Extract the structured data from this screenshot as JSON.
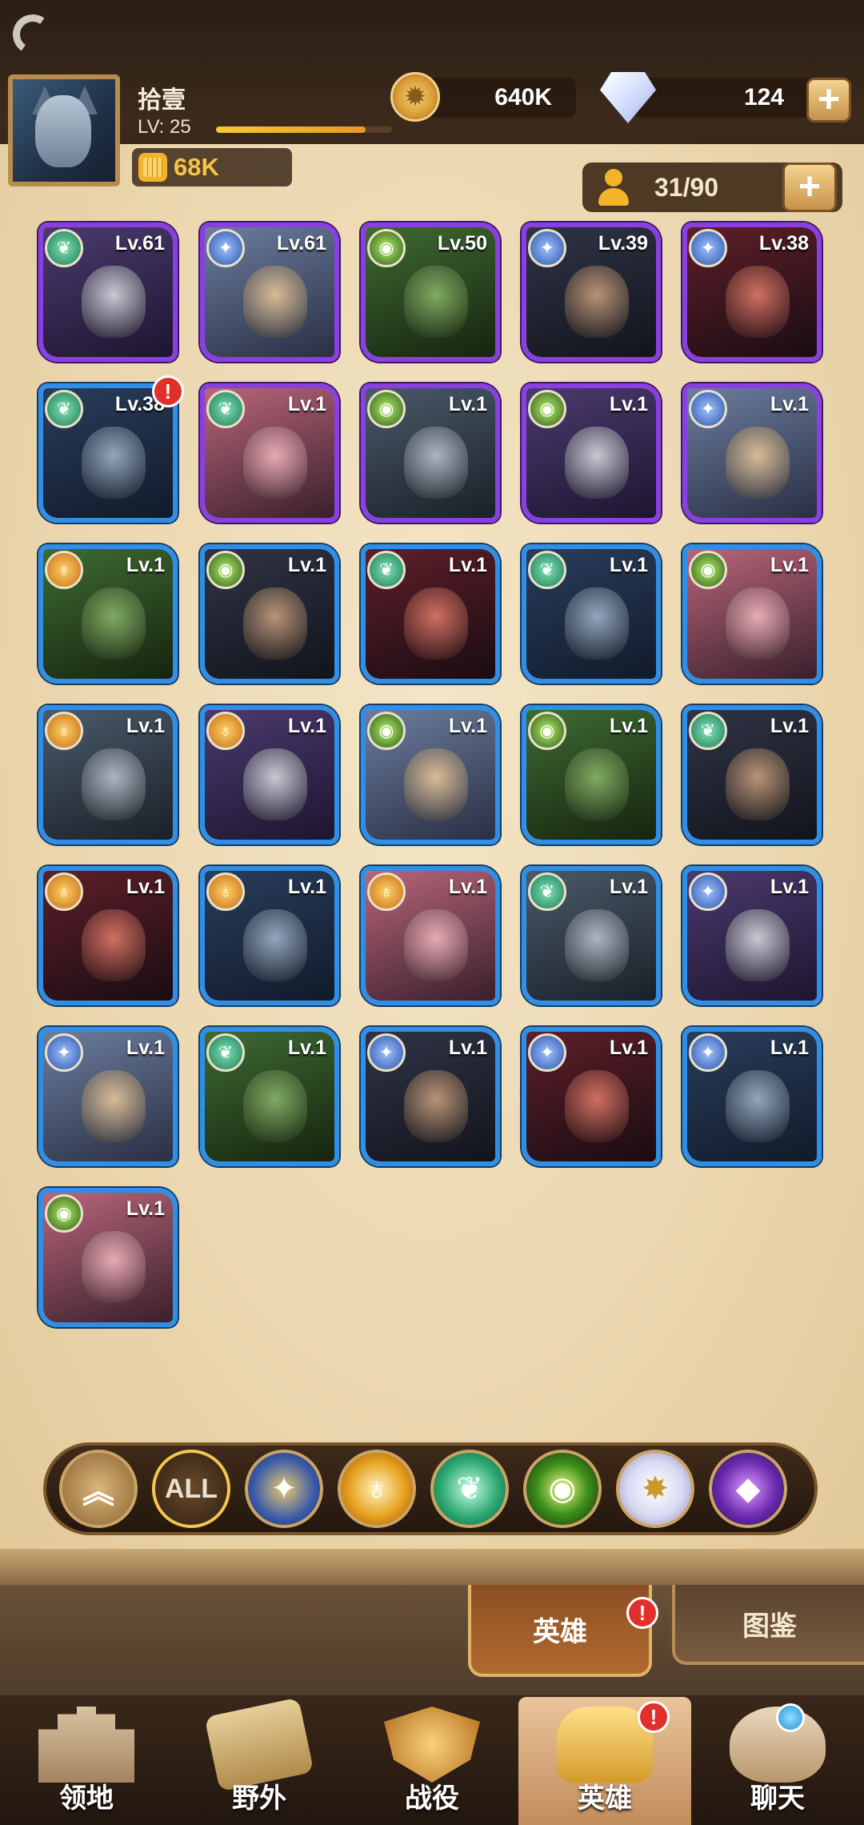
{
  "player": {
    "name": "拾壹",
    "level_label": "LV: 25",
    "xp_progress": 0.85,
    "power": "68K"
  },
  "currency": {
    "gold": "640K",
    "diamonds": "124",
    "gold_plus": "+",
    "diamond_plus": "+"
  },
  "roster": {
    "capacity": "31/90",
    "plus": "+"
  },
  "heroes": [
    {
      "level": "Lv.61",
      "faction": "wild",
      "rarity": "purple"
    },
    {
      "level": "Lv.61",
      "faction": "light",
      "rarity": "purple"
    },
    {
      "level": "Lv.50",
      "faction": "grave",
      "rarity": "purple"
    },
    {
      "level": "Lv.39",
      "faction": "light",
      "rarity": "purple"
    },
    {
      "level": "Lv.38",
      "faction": "light",
      "rarity": "purple"
    },
    {
      "level": "Lv.38",
      "faction": "wild",
      "rarity": "blue",
      "alert": "!"
    },
    {
      "level": "Lv.1",
      "faction": "wild",
      "rarity": "purple"
    },
    {
      "level": "Lv.1",
      "faction": "grave",
      "rarity": "purple"
    },
    {
      "level": "Lv.1",
      "faction": "grave",
      "rarity": "purple"
    },
    {
      "level": "Lv.1",
      "faction": "light",
      "rarity": "purple"
    },
    {
      "level": "Lv.1",
      "faction": "mauler",
      "rarity": "blue"
    },
    {
      "level": "Lv.1",
      "faction": "grave",
      "rarity": "blue"
    },
    {
      "level": "Lv.1",
      "faction": "wild",
      "rarity": "blue"
    },
    {
      "level": "Lv.1",
      "faction": "wild",
      "rarity": "blue"
    },
    {
      "level": "Lv.1",
      "faction": "grave",
      "rarity": "blue"
    },
    {
      "level": "Lv.1",
      "faction": "mauler",
      "rarity": "blue"
    },
    {
      "level": "Lv.1",
      "faction": "mauler",
      "rarity": "blue"
    },
    {
      "level": "Lv.1",
      "faction": "grave",
      "rarity": "blue"
    },
    {
      "level": "Lv.1",
      "faction": "grave",
      "rarity": "blue"
    },
    {
      "level": "Lv.1",
      "faction": "wild",
      "rarity": "blue"
    },
    {
      "level": "Lv.1",
      "faction": "mauler",
      "rarity": "blue"
    },
    {
      "level": "Lv.1",
      "faction": "mauler",
      "rarity": "blue"
    },
    {
      "level": "Lv.1",
      "faction": "mauler",
      "rarity": "blue"
    },
    {
      "level": "Lv.1",
      "faction": "wild",
      "rarity": "blue"
    },
    {
      "level": "Lv.1",
      "faction": "light",
      "rarity": "blue"
    },
    {
      "level": "Lv.1",
      "faction": "light",
      "rarity": "blue"
    },
    {
      "level": "Lv.1",
      "faction": "wild",
      "rarity": "blue"
    },
    {
      "level": "Lv.1",
      "faction": "light",
      "rarity": "blue"
    },
    {
      "level": "Lv.1",
      "faction": "light",
      "rarity": "blue"
    },
    {
      "level": "Lv.1",
      "faction": "light",
      "rarity": "blue"
    },
    {
      "level": "Lv.1",
      "faction": "grave",
      "rarity": "blue"
    }
  ],
  "filters": {
    "all_label": "ALL",
    "items": [
      "rank-up",
      "all",
      "lightbearer",
      "mauler",
      "wilder",
      "graveborn",
      "celestial",
      "hypogean"
    ]
  },
  "subtabs": {
    "hero": "英雄",
    "hero_alert": "!",
    "codex": "图鉴"
  },
  "nav": {
    "territory": "领地",
    "wild": "野外",
    "campaign": "战役",
    "heroes": "英雄",
    "heroes_alert": "!",
    "chat": "聊天"
  }
}
